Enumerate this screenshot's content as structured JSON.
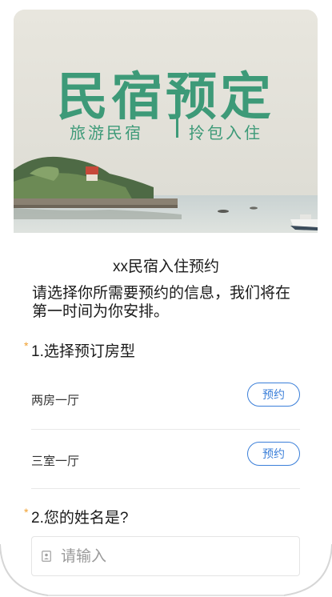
{
  "banner": {
    "title": "民宿预定",
    "subtitle_left": "旅游民宿",
    "subtitle_right": "拎包入住"
  },
  "form": {
    "title": "xx民宿入住预约",
    "description": "请选择你所需要预约的信息，我们将在第一时间为你安排。"
  },
  "question1": {
    "required_mark": "*",
    "label": "1.选择预订房型",
    "options": [
      {
        "name": "两房一厅",
        "button_label": "预约"
      },
      {
        "name": "三室一厅",
        "button_label": "预约"
      }
    ]
  },
  "question2": {
    "required_mark": "*",
    "label": "2.您的姓名是?",
    "input_placeholder": "请输入",
    "input_value": "",
    "icon": "contact-card-icon"
  },
  "colors": {
    "accent": "#3b7fd9",
    "required": "#f0a030",
    "banner_text": "#3d9a78"
  }
}
